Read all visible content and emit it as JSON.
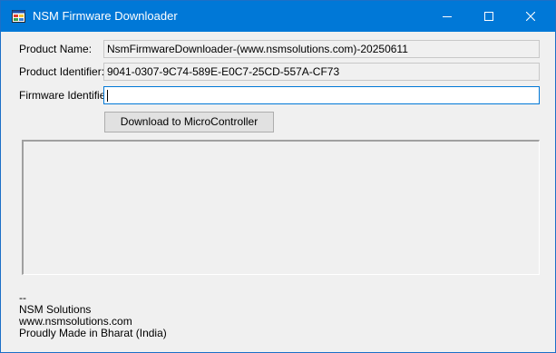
{
  "window": {
    "title": "NSM Firmware Downloader",
    "icon": "app-window-icon",
    "controls": [
      "minimize-icon",
      "maximize-icon",
      "close-icon"
    ],
    "colors": {
      "titlebar": "#0078d7",
      "background": "#f0f0f0",
      "focus_border": "#0078d7"
    }
  },
  "form": {
    "product_name_label": "Product Name:",
    "product_name_value": "NsmFirmwareDownloader-(www.nsmsolutions.com)-20250611",
    "product_identifier_label": "Product Identifier:",
    "product_identifier_value": "9041-0307-9C74-589E-E0C7-25CD-557A-CF73",
    "firmware_identifier_label": "Firmware Identifier:",
    "firmware_identifier_value": "",
    "download_button_label": "Download to MicroController"
  },
  "log": {
    "text": ""
  },
  "footer": {
    "lines": [
      "--",
      "NSM Solutions",
      "www.nsmsolutions.com",
      "Proudly Made in Bharat (India)"
    ]
  }
}
